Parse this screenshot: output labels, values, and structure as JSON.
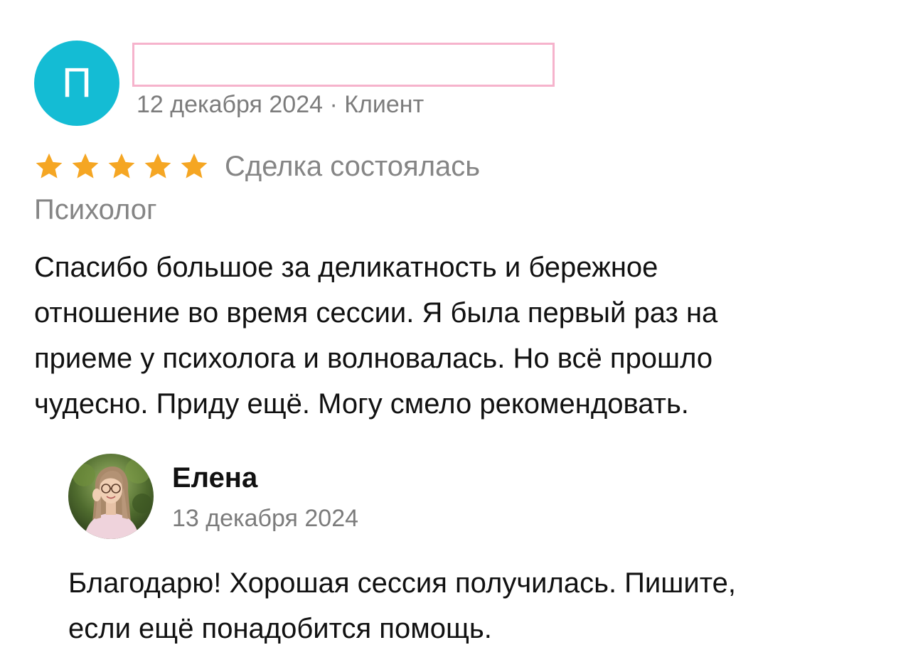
{
  "review": {
    "avatar_letter": "П",
    "author_name": "",
    "meta": "12 декабря 2024 · Клиент",
    "rating": 5,
    "rating_max": 5,
    "deal_status": "Сделка состоялась",
    "service": "Психолог",
    "text_lines": [
      "Спасибо большое за деликатность и бережное",
      "отношение во время сессии. Я была первый раз на",
      "приеме у психолога и волновалась. Но всё прошло",
      "чудесно. Приду ещё. Могу смело рекомендовать."
    ]
  },
  "reply": {
    "author": "Елена",
    "date": "13 декабря 2024",
    "text_lines": [
      "Благодарю! Хорошая сессия получилась. Пишите,",
      "если ещё понадобится помощь."
    ]
  },
  "colors": {
    "avatar_bg": "#14bcd4",
    "star": "#f5a623",
    "redaction_border": "#f6b3cc",
    "muted_text": "#7c7c7c"
  }
}
